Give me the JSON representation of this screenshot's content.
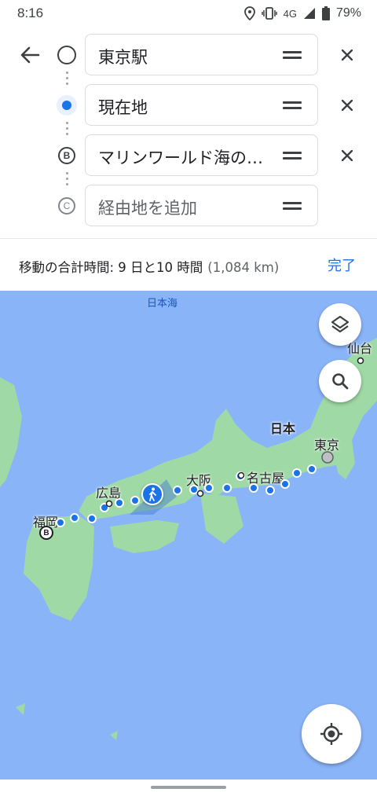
{
  "status_bar": {
    "time": "8:16",
    "network": "4G",
    "battery": "79%",
    "icons": [
      "location-icon",
      "vibrate-icon",
      "signal-icon",
      "battery-icon"
    ]
  },
  "directions": {
    "back_icon": "arrow-back-icon",
    "stops": [
      {
        "marker": "origin-circle",
        "text": "東京駅",
        "placeholder": false
      },
      {
        "marker": "current-location-dot",
        "text": "現在地",
        "placeholder": false
      },
      {
        "marker": "B",
        "text": "マリンワールド海の…",
        "placeholder": false
      },
      {
        "marker": "C",
        "text": "経由地を追加",
        "placeholder": true
      }
    ]
  },
  "summary": {
    "total_time": "移動の合計時間: 9 日と10 時間",
    "distance": "(1,084 km)",
    "done_label": "完了"
  },
  "map": {
    "sea_label": "日本海",
    "labels": {
      "sendai": "仙台",
      "japan": "日本",
      "tokyo": "東京",
      "osaka": "大阪",
      "nagoya": "名古屋",
      "hiroshima": "広島",
      "fukuoka": "福岡"
    },
    "destination_marker": "B",
    "colors": {
      "water": "#8ab4f8",
      "land": "#9fd9a5",
      "route": "#1a73e8"
    }
  },
  "controls": {
    "layers_icon": "layers-icon",
    "search_icon": "search-icon",
    "my_location_icon": "my-location-icon"
  }
}
